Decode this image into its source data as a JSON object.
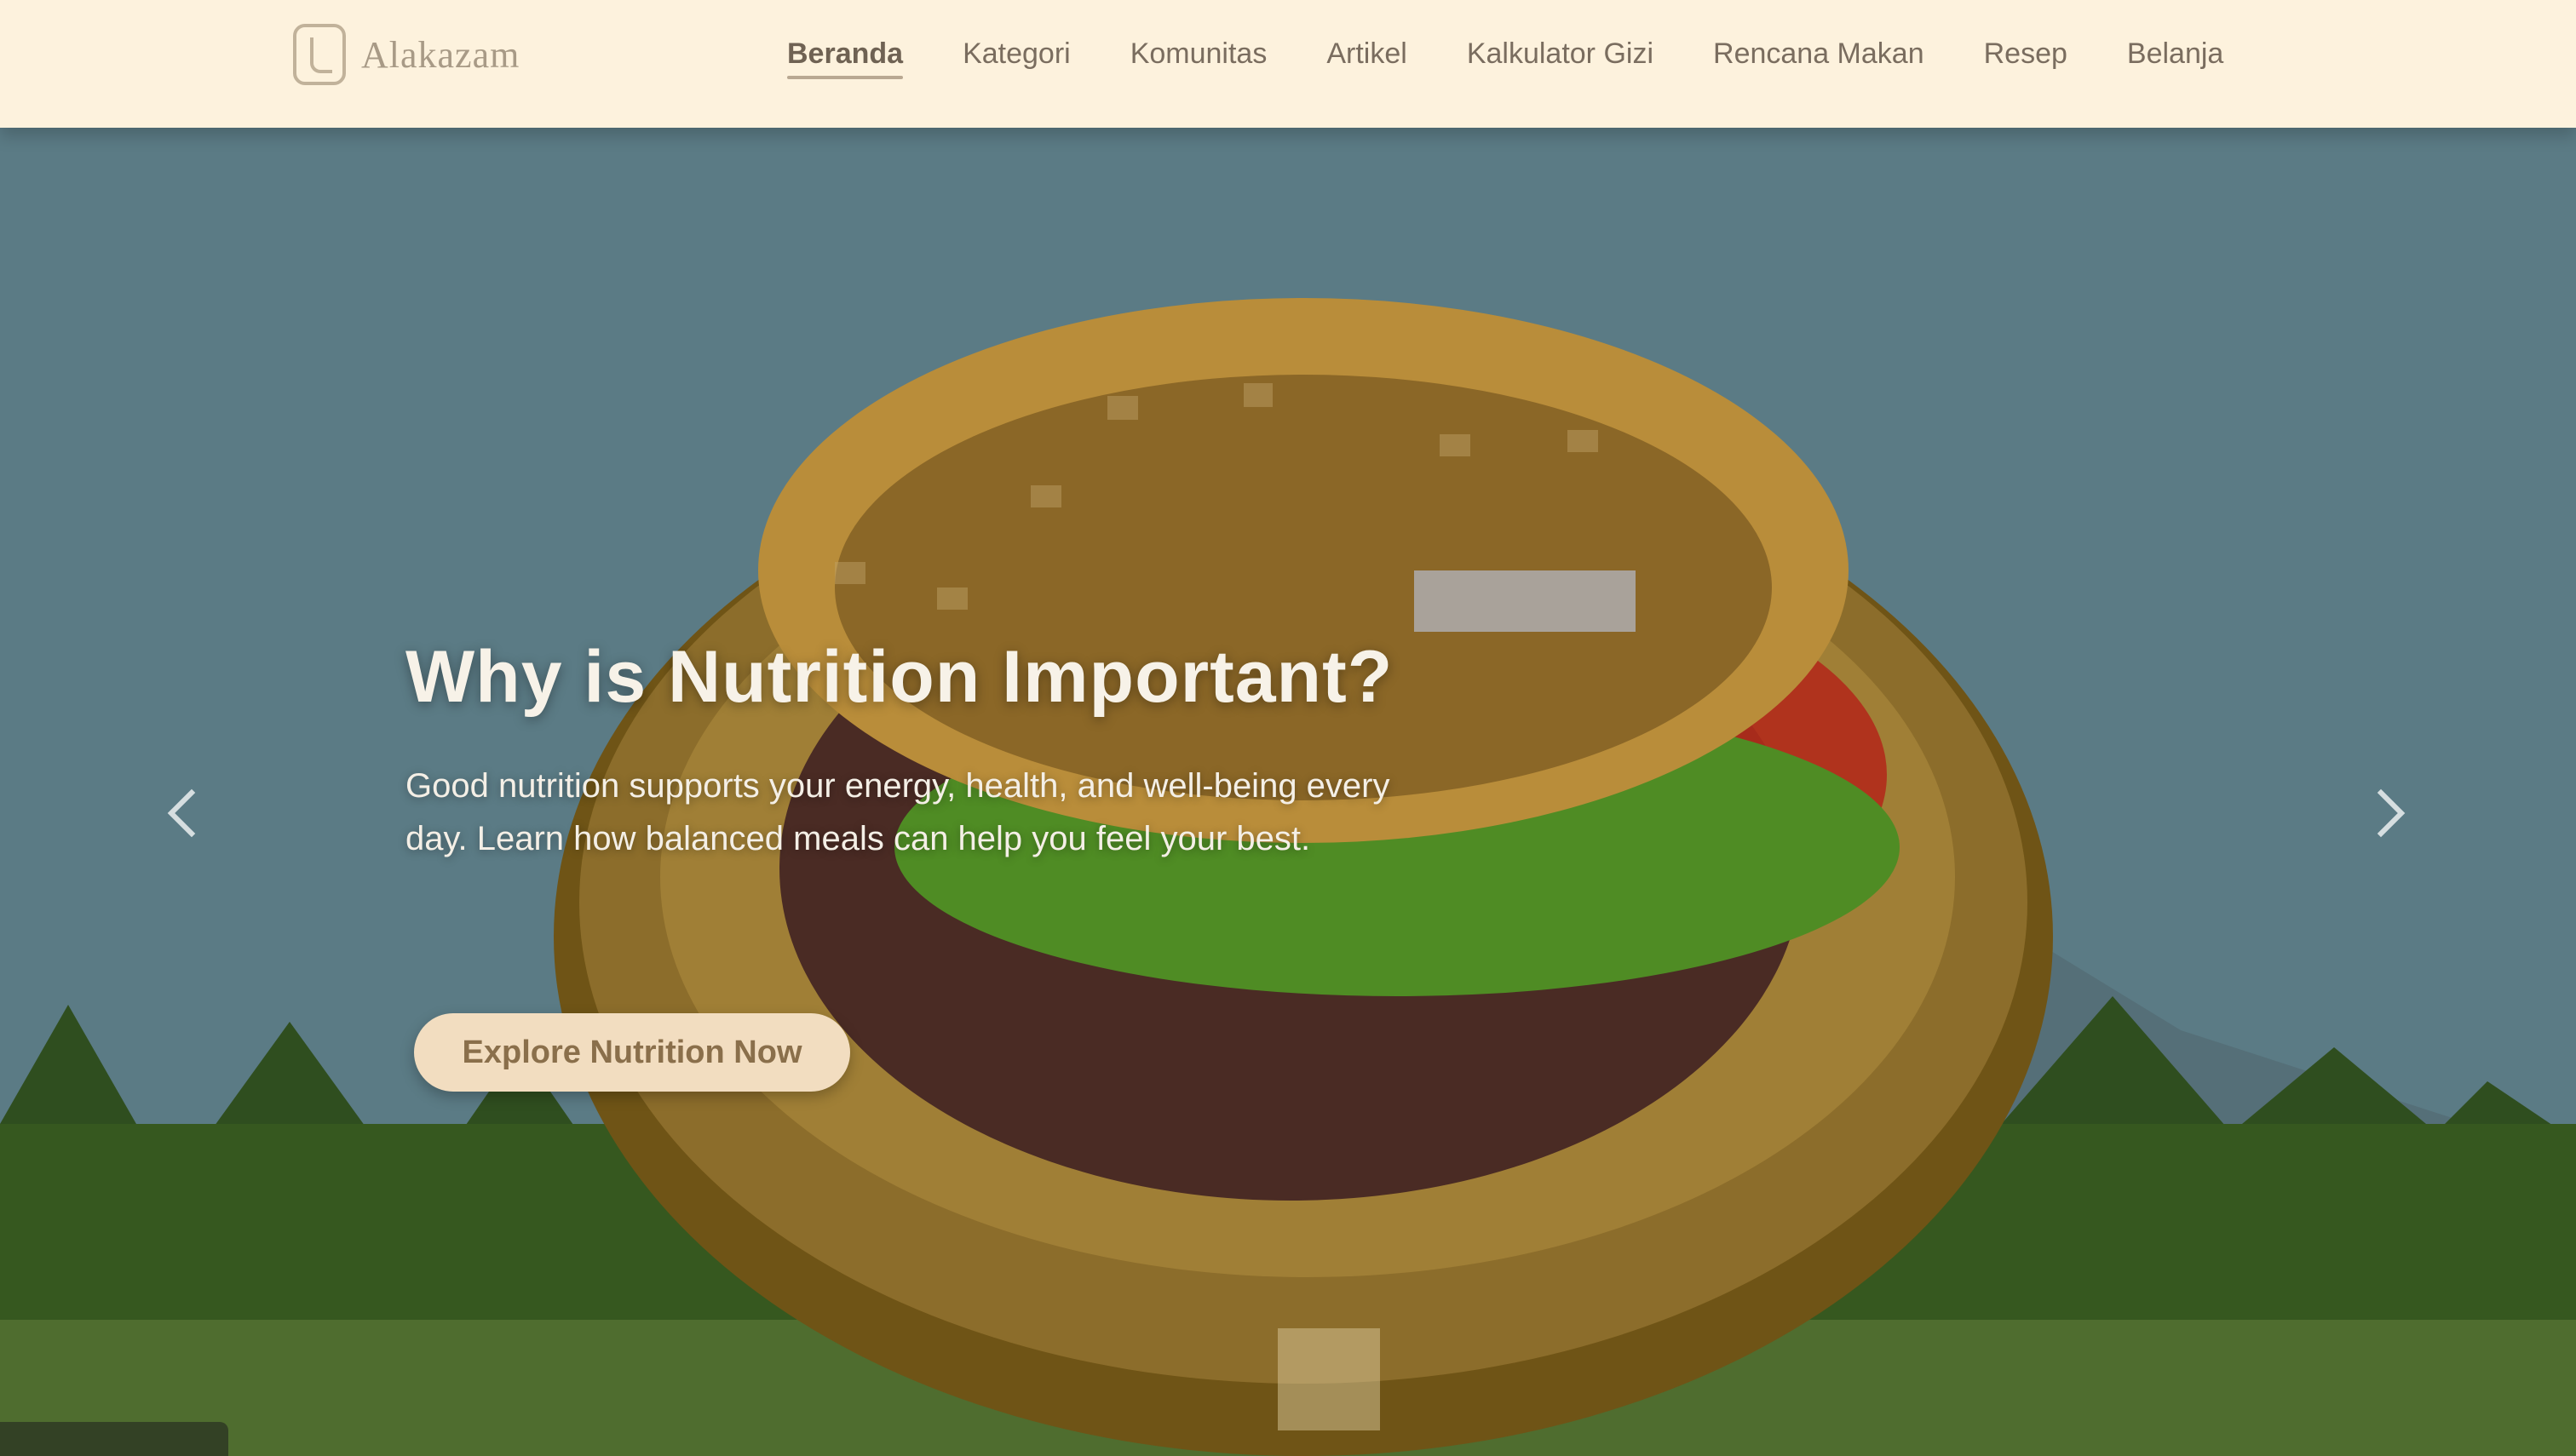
{
  "brand": {
    "name": "Alakazam",
    "logo_icon": "leaf-shield-icon"
  },
  "nav": {
    "items": [
      {
        "label": "Beranda",
        "active": true
      },
      {
        "label": "Kategori"
      },
      {
        "label": "Komunitas"
      },
      {
        "label": "Artikel"
      },
      {
        "label": "Kalkulator Gizi"
      },
      {
        "label": "Rencana Makan"
      },
      {
        "label": "Resep"
      },
      {
        "label": "Belanja"
      }
    ]
  },
  "hero": {
    "title": "Why is Nutrition Important?",
    "subtitle": "Good nutrition supports your energy, health, and well-being every day. Learn how balanced meals can help you feel your best.",
    "cta_label": "Explore Nutrition Now",
    "prev_icon": "chevron-left-icon",
    "next_icon": "chevron-right-icon"
  },
  "colors": {
    "navbar_bg": "#fdf2dd",
    "sky": "#5b7b85",
    "cta_bg": "#f2ddc0"
  }
}
